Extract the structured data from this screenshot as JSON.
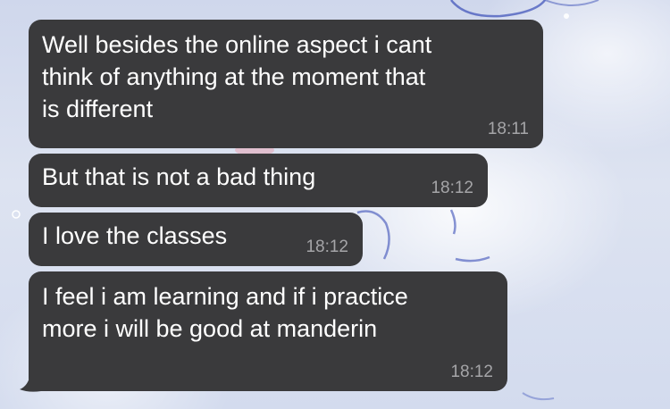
{
  "chat": {
    "messages": [
      {
        "lines": [
          "Well besides the online aspect i cant",
          "think of anything at the moment that",
          "is different"
        ],
        "time": "18:11"
      },
      {
        "lines": [
          "But that is not a bad thing"
        ],
        "time": "18:12"
      },
      {
        "lines": [
          "I love the classes"
        ],
        "time": "18:12"
      },
      {
        "lines": [
          "I feel i am learning and if i practice",
          "more i will be good at manderin"
        ],
        "time": "18:12"
      }
    ]
  },
  "colors": {
    "bubble": "#3a3a3c",
    "text": "#ffffff",
    "timestamp": "#a5a5a8"
  }
}
